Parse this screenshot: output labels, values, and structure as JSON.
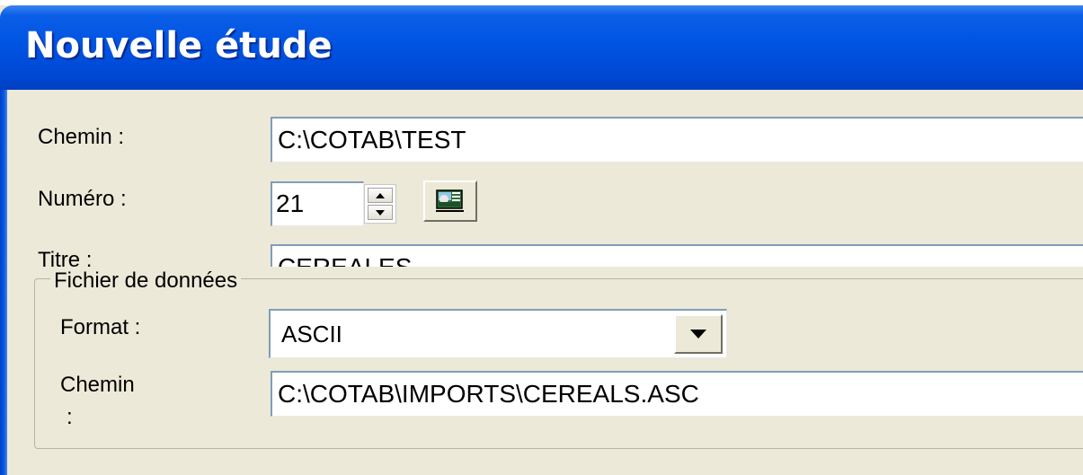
{
  "window": {
    "title": "Nouvelle étude"
  },
  "fields": {
    "chemin_label": "Chemin :",
    "chemin_value": "C:\\COTAB\\TEST",
    "numero_label": "Numéro :",
    "numero_value": "21",
    "titre_label": "Titre :",
    "titre_value": "CEREALES"
  },
  "data_file": {
    "group_label": "Fichier de données",
    "format_label": "Format :",
    "format_value": "ASCII",
    "chemin_label_line1": "Chemin",
    "chemin_label_line2": ":",
    "chemin_value": "C:\\COTAB\\IMPORTS\\CEREALS.ASC"
  },
  "icons": {
    "spin_up": "spin-up-arrow",
    "spin_down": "spin-down-arrow",
    "generate_button": "image-generate-icon",
    "combo_arrow": "chevron-down-icon"
  },
  "colors": {
    "titlebar": "#0054e3",
    "dialog_bg": "#ece9d8",
    "field_border": "#7f9db9"
  }
}
